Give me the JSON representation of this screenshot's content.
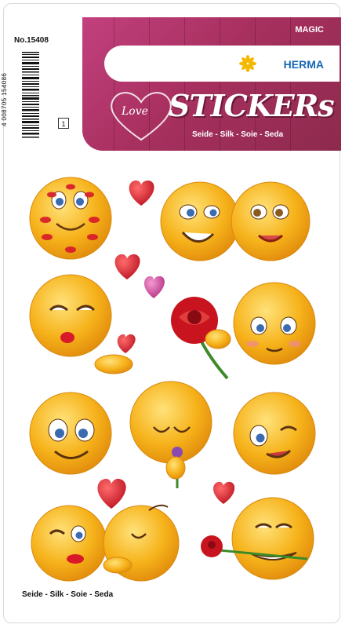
{
  "product": {
    "number": "No.15408",
    "barcode_digits": "4 008705 154086",
    "quantity": "1"
  },
  "header": {
    "magic": "MAGIC",
    "brand": "HERMA",
    "love": "Love",
    "title": "STICKERs",
    "material": "Seide - Silk - Soie - Seda"
  },
  "footer": {
    "material": "Seide - Silk - Soie - Seda"
  },
  "colors": {
    "banner": "#b03a6a",
    "brand_blue": "#1667b3",
    "brand_star": "#f5b800",
    "emoji": "#f6b21a",
    "heart_red": "#d8192a",
    "heart_pink": "#d64aa0"
  },
  "stickers": [
    "emoji-kiss-marks",
    "emoji-couple-cheek",
    "emoji-blowing-kiss",
    "emoji-shy",
    "emoji-smiling-big-eyes",
    "emoji-smelling-flower",
    "emoji-winking",
    "emoji-couple-kiss",
    "emoji-rose-in-mouth",
    "red-rose",
    "red-heart",
    "pink-heart"
  ]
}
